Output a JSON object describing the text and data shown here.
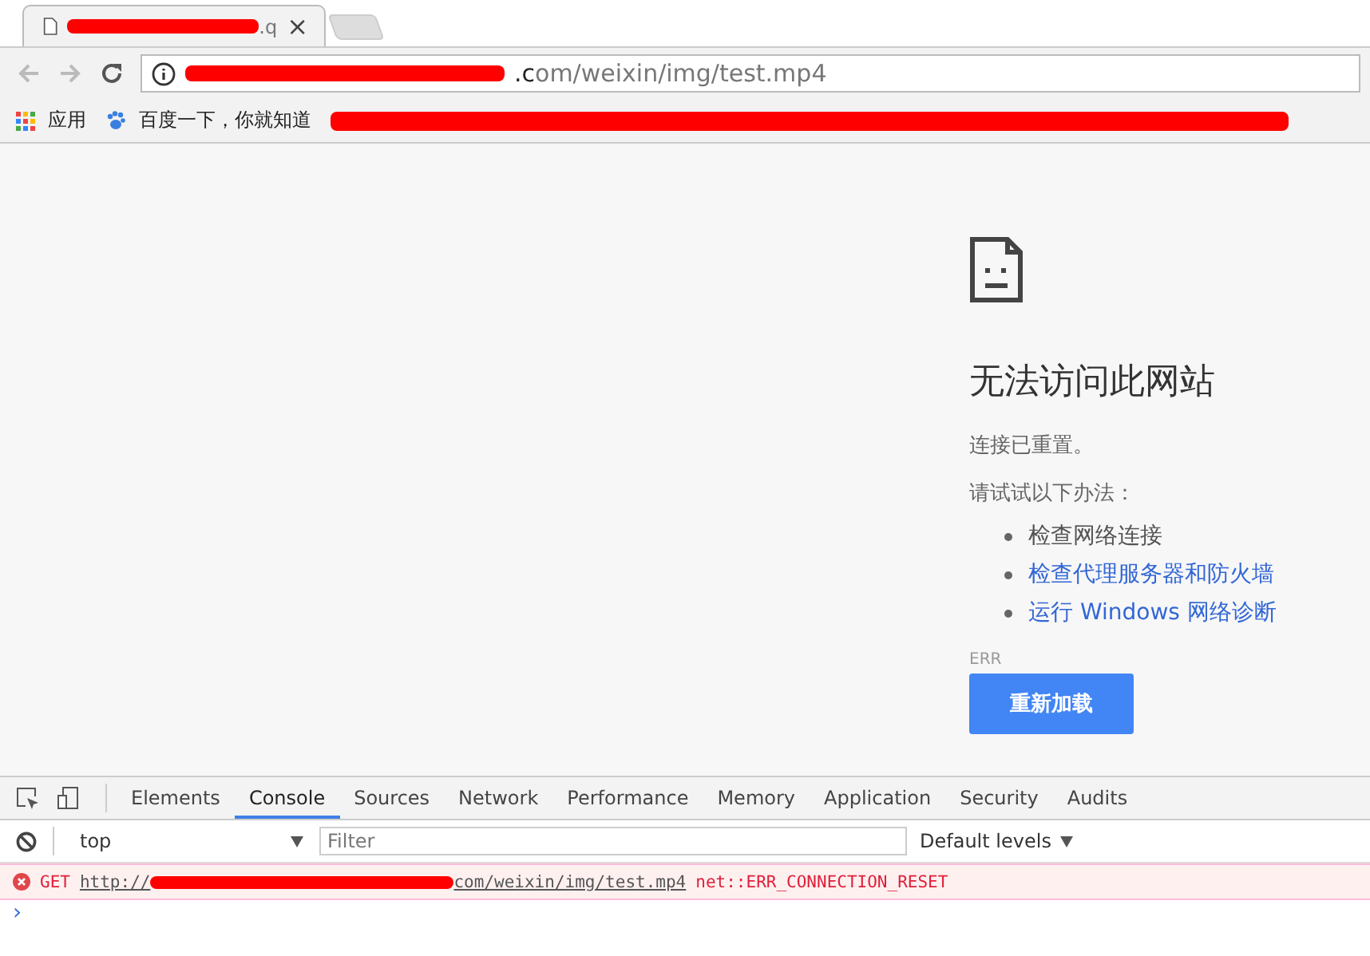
{
  "tabs": [
    {
      "title_visible": ".q",
      "selected": true,
      "close": "×"
    },
    {
      "selected": false
    }
  ],
  "address_bar": {
    "url_visible": ".com/weixin/img/test.mp4"
  },
  "bookmarks": [
    {
      "kind": "apps",
      "label": "应用"
    },
    {
      "kind": "paw",
      "label": "百度一下，你就知道"
    },
    {
      "kind": "redacted"
    }
  ],
  "error_page": {
    "title": "无法访问此网站",
    "message": "连接已重置。",
    "suggestion_heading": "请试试以下办法：",
    "suggestions": [
      {
        "text": "检查网络连接",
        "link": false
      },
      {
        "text": "检查代理服务器和防火墙",
        "link": true
      },
      {
        "text": "运行 Windows 网络诊断",
        "link": true
      }
    ],
    "error_code": "ERR",
    "reload_button": "重新加载"
  },
  "devtools": {
    "tabs": [
      {
        "label": "Elements",
        "selected": false
      },
      {
        "label": "Console",
        "selected": true
      },
      {
        "label": "Sources",
        "selected": false
      },
      {
        "label": "Network",
        "selected": false
      },
      {
        "label": "Performance",
        "selected": false
      },
      {
        "label": "Memory",
        "selected": false
      },
      {
        "label": "Application",
        "selected": false
      },
      {
        "label": "Security",
        "selected": false
      },
      {
        "label": "Audits",
        "selected": false
      }
    ],
    "context": "top",
    "filter_placeholder": "Filter",
    "levels": "Default levels",
    "messages": [
      {
        "kind": "error",
        "method": "GET",
        "url_start": "http://",
        "url_end": "com/weixin/img/test.mp4",
        "detail": "net::ERR_CONNECTION_RESET"
      }
    ],
    "prompt": "›"
  }
}
